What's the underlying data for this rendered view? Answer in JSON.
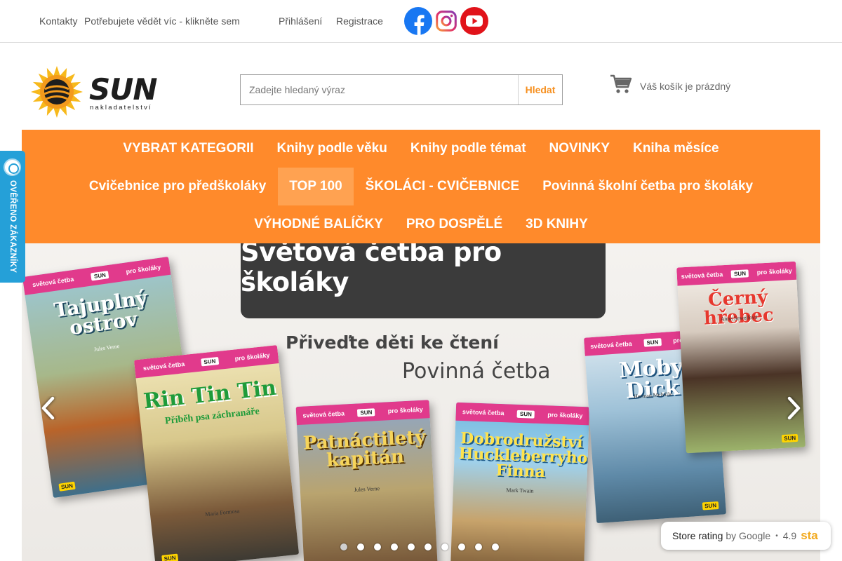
{
  "topbar": {
    "contacts": "Kontakty",
    "more_info": "Potřebujete vědět víc - klikněte sem",
    "login": "Přihlášení",
    "register": "Registrace"
  },
  "social": {
    "facebook": "facebook-icon",
    "instagram": "instagram-icon",
    "youtube": "youtube-icon",
    "colors": {
      "facebook": "#1877f2",
      "youtube": "#e1131a"
    }
  },
  "logo": {
    "wordmark": "SUN",
    "tagline": "nakladatelství"
  },
  "search": {
    "placeholder": "Zadejte hledaný výraz",
    "button": "Hledat"
  },
  "cart": {
    "icon": "cart-icon",
    "status": "Váš košík je prázdný"
  },
  "nav": {
    "accent": "#ff8a2b",
    "row1": [
      "VYBRAT KATEGORII",
      "Knihy podle věku",
      "Knihy podle témat",
      "NOVINKY",
      "Kniha měsíce"
    ],
    "row2": [
      "Cvičebnice pro předškoláky",
      "TOP 100",
      "ŠKOLÁCI - CVIČEBNICE",
      "Povinná školní četba pro školáky"
    ],
    "row3": [
      "VÝHODNÉ BALÍČKY",
      "PRO DOSPĚLÉ",
      "3D KNIHY"
    ],
    "active": "TOP 100"
  },
  "badge": {
    "text": "OVĚŘENO ZÁKAZNÍKY",
    "color": "#25a0d8"
  },
  "banner": {
    "headline": "Světová četba pro školáky",
    "sub1": "Přiveďte děti ke čtení",
    "sub2": "Povinná četba",
    "series_left": "světová četba",
    "series_right": "pro školáky",
    "publisher": "SUN",
    "books": [
      {
        "title": "Tajuplný ostrov",
        "author": "Jules Verne"
      },
      {
        "title": "Rin Tin Tin",
        "subtitle": "Příběh psa záchranáře",
        "author": "Maria Formosa"
      },
      {
        "title": "Patnáctiletý kapitán",
        "author": "Jules Verne"
      },
      {
        "title": "Dobrodružství Huckleberryho Finna",
        "author": "Mark Twain"
      },
      {
        "title": "Moby Dick",
        "author": "Herman Melville"
      },
      {
        "title": "Černý hřebec",
        "author": "Anna Sewellová"
      }
    ],
    "slides": 10,
    "active_slide": 1
  },
  "rating": {
    "label": "Store rating",
    "by": "by Google",
    "score": "4.9",
    "stars": "sta"
  }
}
